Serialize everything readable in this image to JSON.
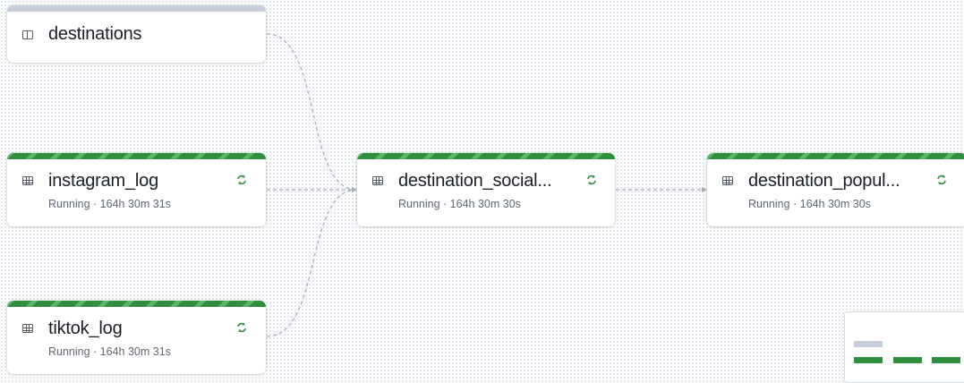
{
  "nodes": [
    {
      "name": "destinations",
      "type": "view",
      "status": ""
    },
    {
      "name": "instagram_log",
      "type": "table",
      "status": "Running · 164h 30m 31s"
    },
    {
      "name": "tiktok_log",
      "type": "table",
      "status": "Running · 164h 30m 31s"
    },
    {
      "name": "destination_social...",
      "type": "table",
      "status": "Running · 164h 30m 30s"
    },
    {
      "name": "destination_popul...",
      "type": "table",
      "status": "Running · 164h 30m 30s"
    }
  ],
  "icons": {
    "view": "view-icon",
    "table": "table-icon",
    "sync": "refresh-icon"
  },
  "colors": {
    "running_green": "#2f8f3e",
    "stripe_light": "#5cb36a",
    "pending_gray": "#c5ceda",
    "edge": "#a9adb3"
  }
}
